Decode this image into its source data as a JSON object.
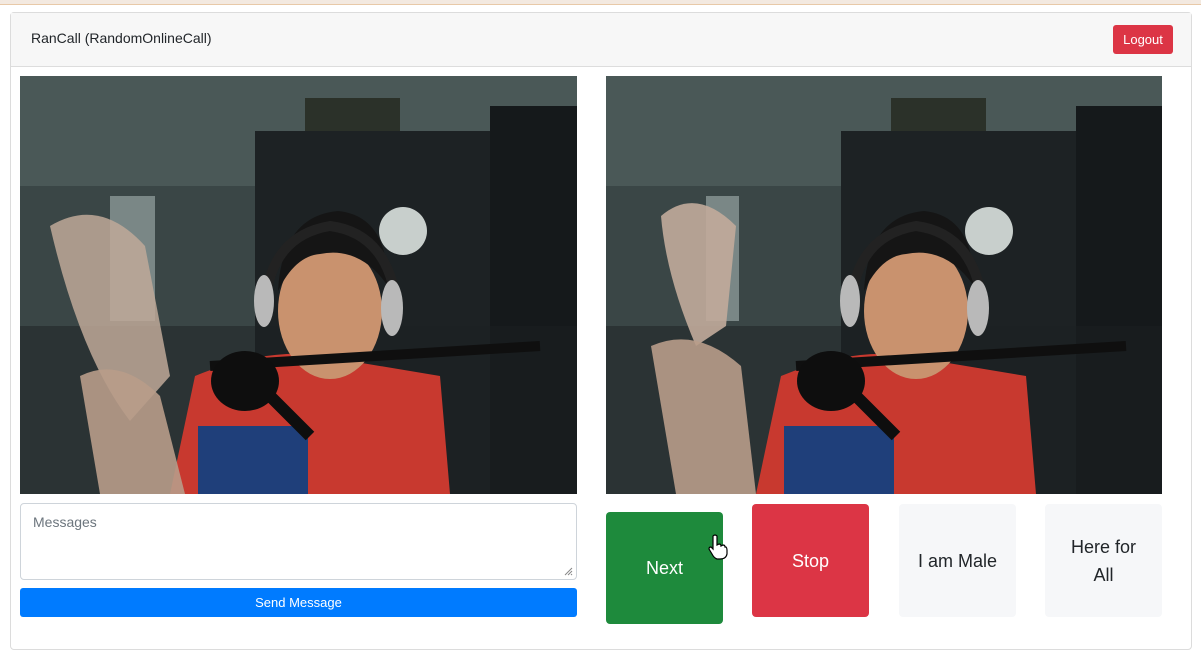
{
  "header": {
    "title": "RanCall (RandomOnlineCall)",
    "logout_label": "Logout"
  },
  "chat": {
    "placeholder": "Messages",
    "send_label": "Send Message"
  },
  "controls": {
    "next_label": "Next",
    "stop_label": "Stop",
    "gender_label": "I am Male",
    "preference_label": "Here for All"
  },
  "colors": {
    "logout": "#dc3545",
    "send": "#007bff",
    "next": "#1e8a3c",
    "stop": "#dc3545",
    "neutral": "#f6f7f9"
  },
  "icons": {
    "cursor": "hand-pointer-icon"
  }
}
